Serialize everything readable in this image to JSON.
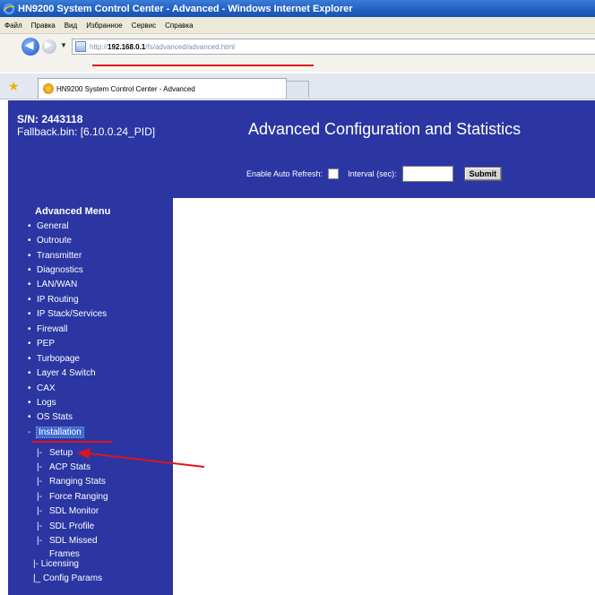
{
  "window": {
    "title": "HN9200 System Control Center - Advanced - Windows Internet Explorer"
  },
  "menubar": [
    "Файл",
    "Правка",
    "Вид",
    "Избранное",
    "Сервис",
    "Справка"
  ],
  "address": {
    "prefix": "http://",
    "host": "192.168.0.1",
    "path": "/fs/advanced/advanced.html"
  },
  "tab": {
    "label": "HN9200 System Control Center - Advanced"
  },
  "device": {
    "sn": "S/N: 2443118",
    "fallback": "Fallback.bin: [6.10.0.24_PID]"
  },
  "header": {
    "title": "Advanced Configuration and Statistics",
    "auto_refresh_label": "Enable Auto Refresh:",
    "interval_label": "Interval (sec):",
    "submit_label": "Submit"
  },
  "advanced_menu": {
    "title": "Advanced Menu",
    "items": [
      "General",
      "Outroute",
      "Transmitter",
      "Diagnostics",
      "LAN/WAN",
      "IP Routing",
      "IP Stack/Services",
      "Firewall",
      "PEP",
      "Turbopage",
      "Layer 4 Switch",
      "CAX",
      "Logs",
      "OS Stats"
    ],
    "installation": "Installation",
    "installation_sub": [
      "Setup",
      "ACP Stats",
      "Ranging Stats",
      "Force Ranging",
      "SDL Monitor",
      "SDL Profile",
      "SDL Missed"
    ],
    "frames_label": "Frames",
    "licensing": "Licensing",
    "config_params": "Config Params"
  },
  "colors": {
    "panel": "#2b36a3",
    "annotation": "#e0141a",
    "selected": "#3d6bd6"
  }
}
